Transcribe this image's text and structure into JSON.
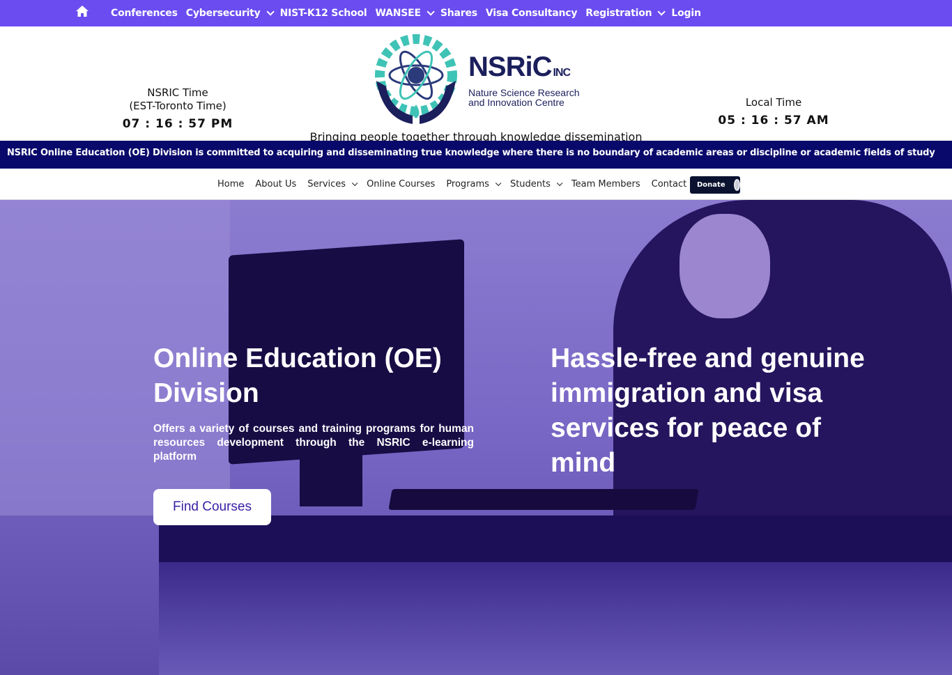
{
  "topbar": {
    "background": "#6a4cf0",
    "home_icon": "home-icon",
    "items": [
      {
        "label": "Conferences",
        "dropdown": false
      },
      {
        "label": "Cybersecurity",
        "dropdown": true
      },
      {
        "label": "NIST-K12 School",
        "dropdown": false
      },
      {
        "label": "WANSEE",
        "dropdown": true
      },
      {
        "label": "Shares",
        "dropdown": false
      },
      {
        "label": "Visa Consultancy",
        "dropdown": false
      },
      {
        "label": "Registration",
        "dropdown": true
      },
      {
        "label": "Login",
        "dropdown": false
      }
    ]
  },
  "header": {
    "nsric_clock": {
      "line1": "NSRIC Time",
      "line2": "(EST-Toronto Time)",
      "time": "07 : 16 : 57 PM"
    },
    "local_clock": {
      "line1": "Local Time",
      "time": "05 : 16 : 57 AM"
    },
    "logo": {
      "brand": "NSRiC",
      "inc": "INC",
      "sub1": "Nature Science Research",
      "sub2": "and Innovation Centre"
    },
    "tagline": "Bringing people together through knowledge dissemination"
  },
  "ticker": {
    "text": "NSRIC Online Education (OE) Division is committed to acquiring and disseminating true knowledge where there is no boundary of academic areas or discipline or academic fields of study",
    "background": "#08096b"
  },
  "mainnav": {
    "items": [
      {
        "label": "Home",
        "dropdown": false
      },
      {
        "label": "About Us",
        "dropdown": false
      },
      {
        "label": "Services",
        "dropdown": true
      },
      {
        "label": "Online Courses",
        "dropdown": false
      },
      {
        "label": "Programs",
        "dropdown": true
      },
      {
        "label": "Students",
        "dropdown": true
      },
      {
        "label": "Team Members",
        "dropdown": false
      },
      {
        "label": "Contact",
        "dropdown": false
      }
    ],
    "donate_label": "Donate"
  },
  "hero": {
    "left_title": "Online Education (OE) Division",
    "left_text": "Offers a variety of courses and training programs for human resources development through the NSRIC e-learning platform",
    "button_label": "Find Courses",
    "right_title": "Hassle-free and genuine immigration and visa services for peace of mind"
  }
}
